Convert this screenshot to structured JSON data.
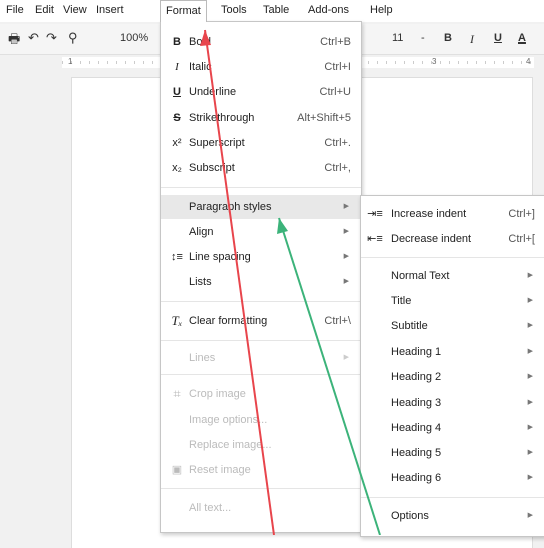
{
  "menubar": [
    "File",
    "Edit",
    "View",
    "Insert",
    "Format",
    "Tools",
    "Table",
    "Add-ons",
    "Help"
  ],
  "toolbar": {
    "zoom": "100%",
    "font_size": "11",
    "font_size_arrow": "-",
    "bold": "B",
    "italic": "I",
    "underline": "U",
    "text_color": "A"
  },
  "ruler": {
    "left_num": "1",
    "mid_num": "3",
    "right_num": "4"
  },
  "format_menu": {
    "bold": {
      "icon": "B",
      "label": "Bold",
      "shortcut": "Ctrl+B"
    },
    "italic": {
      "icon": "I",
      "label": "Italic",
      "shortcut": "Ctrl+I"
    },
    "underline": {
      "icon": "U",
      "label": "Underline",
      "shortcut": "Ctrl+U"
    },
    "strikethrough": {
      "icon": "S",
      "label": "Strikethrough",
      "shortcut": "Alt+Shift+5"
    },
    "superscript": {
      "icon": "x²",
      "label": "Superscript",
      "shortcut": "Ctrl+."
    },
    "subscript": {
      "icon": "x₂",
      "label": "Subscript",
      "shortcut": "Ctrl+,"
    },
    "paragraph_styles": "Paragraph styles",
    "align": "Align",
    "line_spacing": "Line spacing",
    "lists": "Lists",
    "clear_formatting": {
      "label": "Clear formatting",
      "shortcut": "Ctrl+\\"
    },
    "lines": "Lines",
    "crop_image": "Crop image",
    "image_options": "Image options...",
    "replace_image": "Replace image...",
    "reset_image": "Reset image",
    "all_text": "All text..."
  },
  "paragraph_menu": {
    "increase_indent": {
      "label": "Increase indent",
      "shortcut": "Ctrl+]"
    },
    "decrease_indent": {
      "label": "Decrease indent",
      "shortcut": "Ctrl+["
    },
    "styles": [
      "Normal Text",
      "Title",
      "Subtitle",
      "Heading 1",
      "Heading 2",
      "Heading 3",
      "Heading 4",
      "Heading 5",
      "Heading 6"
    ],
    "options": "Options"
  },
  "colors": {
    "red_arrow": "#e8454c",
    "green_arrow": "#3cb37a",
    "highlight": "#e8e8e8"
  }
}
